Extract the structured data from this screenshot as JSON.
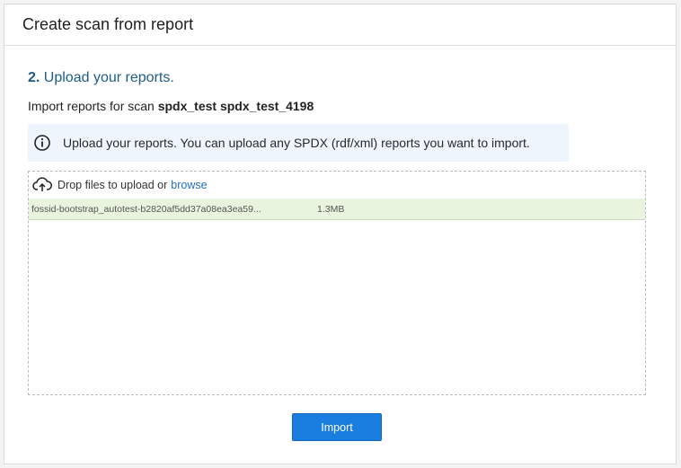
{
  "panel": {
    "title": "Create scan from report"
  },
  "step": {
    "number": "2.",
    "title": "Upload your reports."
  },
  "import_info": {
    "prefix": "Import reports for scan",
    "scan_name": "spdx_test spdx_test_4198"
  },
  "info_box": {
    "icon": "info-circle-icon",
    "text": "Upload your reports. You can upload any SPDX (rdf/xml) reports you want to import."
  },
  "dropzone": {
    "icon": "cloud-upload-icon",
    "prompt": "Drop files to upload or",
    "browse_label": "browse",
    "files": [
      {
        "name": "fossid-bootstrap_autotest-b2820af5dd37a08ea3ea59...",
        "size": "1.3MB"
      }
    ]
  },
  "actions": {
    "import_label": "Import"
  },
  "colors": {
    "accent": "#1a7de0",
    "heading": "#1d5c8a",
    "info_bg": "#eef5fc",
    "file_row_bg": "#e9f4df"
  }
}
